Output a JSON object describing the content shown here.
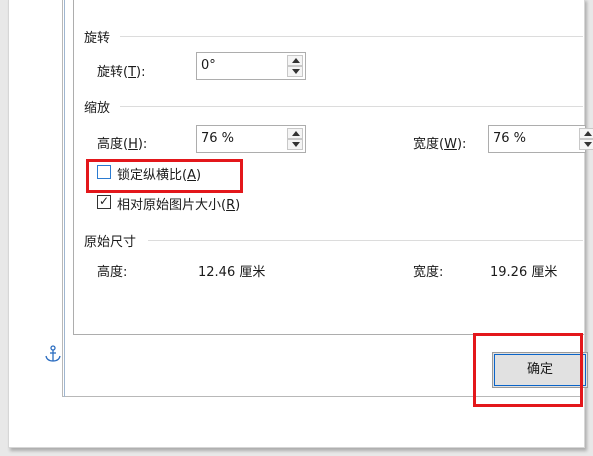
{
  "dialog": {
    "rotation": {
      "section_title": "旋转",
      "rotation_label_prefix": "旋转(",
      "rotation_label_key": "T",
      "rotation_label_suffix": "):",
      "rotation_value": "0°"
    },
    "scale": {
      "section_title": "缩放",
      "height_label_prefix": "高度(",
      "height_label_key": "H",
      "height_label_suffix": "):",
      "height_value": "76 %",
      "width_label_prefix": "宽度(",
      "width_label_key": "W",
      "width_label_suffix": "):",
      "width_value": "76 %",
      "lock_aspect_prefix": "锁定纵横比(",
      "lock_aspect_key": "A",
      "lock_aspect_suffix": ")",
      "lock_aspect_checked": false,
      "relative_prefix": "相对原始图片大小(",
      "relative_key": "R",
      "relative_suffix": ")",
      "relative_checked": true
    },
    "original_size": {
      "section_title": "原始尺寸",
      "height_label": "高度:",
      "height_value": "12.46 厘米",
      "width_label": "宽度:",
      "width_value": "19.26 厘米"
    },
    "ok_button": "确定"
  },
  "icons": {
    "anchor": "anchor-icon",
    "highlight_color": "#e3171b"
  }
}
